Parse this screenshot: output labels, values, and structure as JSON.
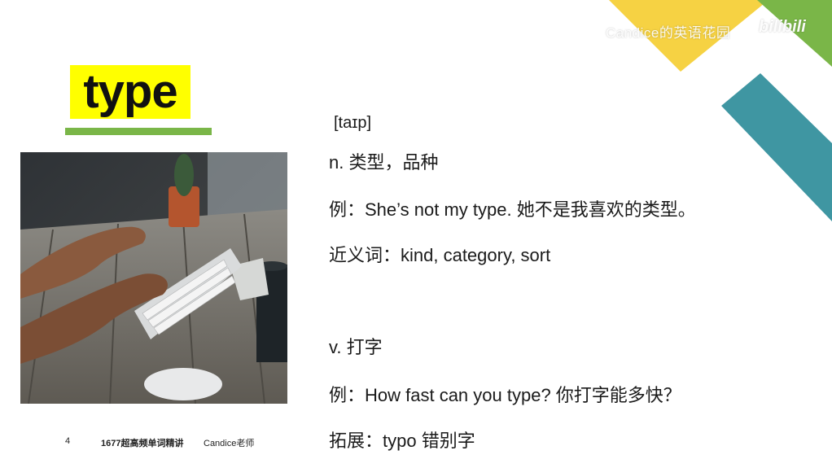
{
  "watermark": {
    "channel": "Candice的英语花园",
    "logo": "bilibili"
  },
  "word": {
    "title": "type",
    "phonetic": "[taɪp]"
  },
  "photo": {
    "icon": "typing-on-keyboard-photo"
  },
  "definitions": {
    "noun_meaning": "n. 类型，品种",
    "noun_example": "例：She’s not my type. 她不是我喜欢的类型。",
    "synonyms": "近义词：kind, category, sort",
    "verb_meaning": "v. 打字",
    "verb_example": "例：How fast can you type? 你打字能多快？",
    "extension": "拓展：typo 错别字"
  },
  "footer": {
    "page_number": "4",
    "course": "1677超高频单词精讲",
    "teacher": "Candice老师"
  },
  "colors": {
    "yellow": "#f6d243",
    "green": "#7ab648",
    "teal": "#3f96a2",
    "highlight": "#ffff00"
  }
}
